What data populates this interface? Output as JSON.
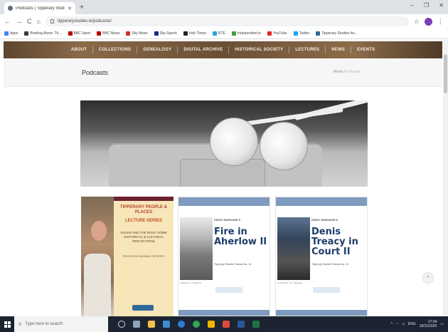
{
  "browser": {
    "tab_title": "Podcasts | Tipperary Studies",
    "new_tab": "+",
    "url": "tipperarystudies.ie/podcasts/",
    "window_controls": [
      "–",
      "❐",
      "✕"
    ]
  },
  "bookmarks": [
    {
      "label": "Apps",
      "color": "#4285f4"
    },
    {
      "label": "Bowling Alone: Th...",
      "color": "#3a3a3a"
    },
    {
      "label": "BBC Sport",
      "color": "#b80000"
    },
    {
      "label": "BBC News",
      "color": "#b80000"
    },
    {
      "label": "Sky News",
      "color": "#d42b2b"
    },
    {
      "label": "Sky Sports",
      "color": "#1a2a8a"
    },
    {
      "label": "Irish Times",
      "color": "#222222"
    },
    {
      "label": "RTE",
      "color": "#2aa0d8"
    },
    {
      "label": "Independent.ie",
      "color": "#3f9f3f"
    },
    {
      "label": "YouTube",
      "color": "#e52222"
    },
    {
      "label": "Twitter",
      "color": "#1da1f2"
    },
    {
      "label": "Tipperary Studies ho...",
      "color": "#2f6a9a"
    }
  ],
  "site_nav": [
    "ABOUT",
    "COLLECTIONS",
    "GENEALOGY",
    "DIGITAL ARCHIVE",
    "HISTORICAL SOCIETY",
    "LECTURES",
    "NEWS",
    "EVENTS"
  ],
  "page": {
    "title": "Podcasts",
    "breadcrumb_home": "Home",
    "breadcrumb_current": "Podcasts"
  },
  "cards": [
    {
      "series_title": "TIPPERARY PEOPLE & PLACES",
      "series_sub": "LECTURE SERIES",
      "lecture_title": "SILVER AND THE IRISH: SOME HISTORICAL & CULTURAL REFLECTIONS",
      "speaker": "PROFESSOR DIARMAID FERRITER"
    },
    {
      "author": "DENIS MARNANE'S",
      "title": "Fire in Aherlow II",
      "subtitle": "Tipperary Studies Podcast No. 16",
      "caption": "Aherlow, Co. Tipperary"
    },
    {
      "author": "DENIS MARNANE'S",
      "title": "Denis Treacy in Court II",
      "subtitle": "Tipperary Studies Podcast No. 15",
      "caption": "Courthouse, Co. Tipperary"
    }
  ],
  "scroll_top": "^",
  "taskbar": {
    "search_placeholder": "Type here to search",
    "time": "17:04",
    "date": "18/11/2020",
    "language": "ENG"
  }
}
